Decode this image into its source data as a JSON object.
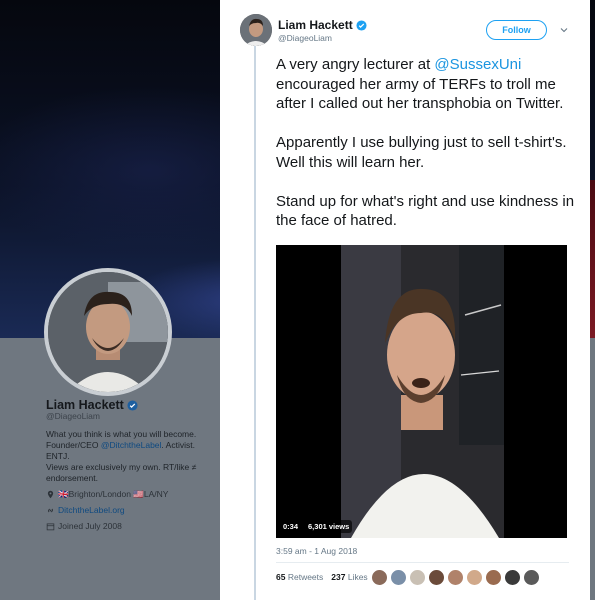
{
  "profile": {
    "name": "Liam Hackett",
    "handle": "@DiageoLiam",
    "bio_line1": "What you think is what you will become.",
    "bio_line2_prefix": "Founder/CEO ",
    "bio_line2_link": "@DitchtheLabel",
    "bio_line2_suffix": ". Activist. ENTJ.",
    "bio_line3": "Views are exclusively my own. RT/like ≠",
    "bio_line4": "endorsement.",
    "location": "🇬🇧Brighton/London 🇺🇸LA/NY",
    "website": "DitchtheLabel.org",
    "joined": "Joined July 2008"
  },
  "tweet": {
    "author_name": "Liam Hackett",
    "author_handle": "@DiageoLiam",
    "follow_label": "Follow",
    "para1_a": "A very angry lecturer at ",
    "para1_mention": "@SussexUni",
    "para1_b": " encouraged her army of TERFs to troll me after I called out her transphobia on Twitter.",
    "para2": "Apparently I use bullying just to sell t-shirt's. Well this will learn her.",
    "para3": "Stand up for what's right and use kindness in the face of hatred.",
    "video_time": "0:34",
    "video_views": "6,301 views",
    "timestamp": "3:59 am - 1 Aug 2018",
    "retweets_count": "65",
    "retweets_label": "Retweets",
    "likes_count": "237",
    "likes_label": "Likes"
  },
  "colors": {
    "accent": "#1da1f2",
    "mention": "#1b95e0",
    "verified": "#1da1f2"
  },
  "likers": [
    "#8a6a5a",
    "#7a8fa8",
    "#c9c0b4",
    "#6b4b3a",
    "#b0826a",
    "#d1a98a",
    "#9a6b4f",
    "#3a3a3a",
    "#5a5a5a"
  ]
}
